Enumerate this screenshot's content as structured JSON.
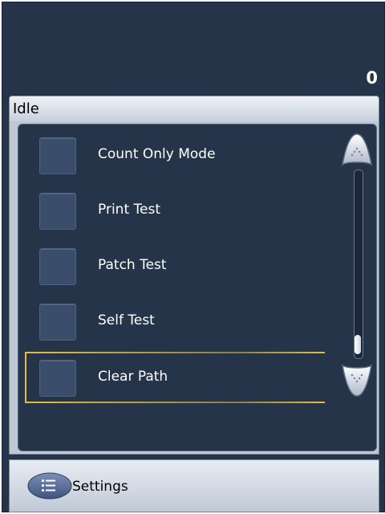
{
  "counter": "0",
  "status": "Idle",
  "list": {
    "items": [
      {
        "label": "Count Only Mode",
        "checked": false,
        "selected": false
      },
      {
        "label": "Print Test",
        "checked": false,
        "selected": false
      },
      {
        "label": "Patch Test",
        "checked": false,
        "selected": false
      },
      {
        "label": "Self Test",
        "checked": false,
        "selected": false
      },
      {
        "label": "Clear Path",
        "checked": false,
        "selected": true
      }
    ],
    "scroll_position": 0.9
  },
  "bottom": {
    "settings_label": "Settings",
    "settings_icon": "list-menu-icon"
  },
  "colors": {
    "background": "#263449",
    "selection": "#e2bf3b",
    "panel": "#c7cfdc"
  }
}
